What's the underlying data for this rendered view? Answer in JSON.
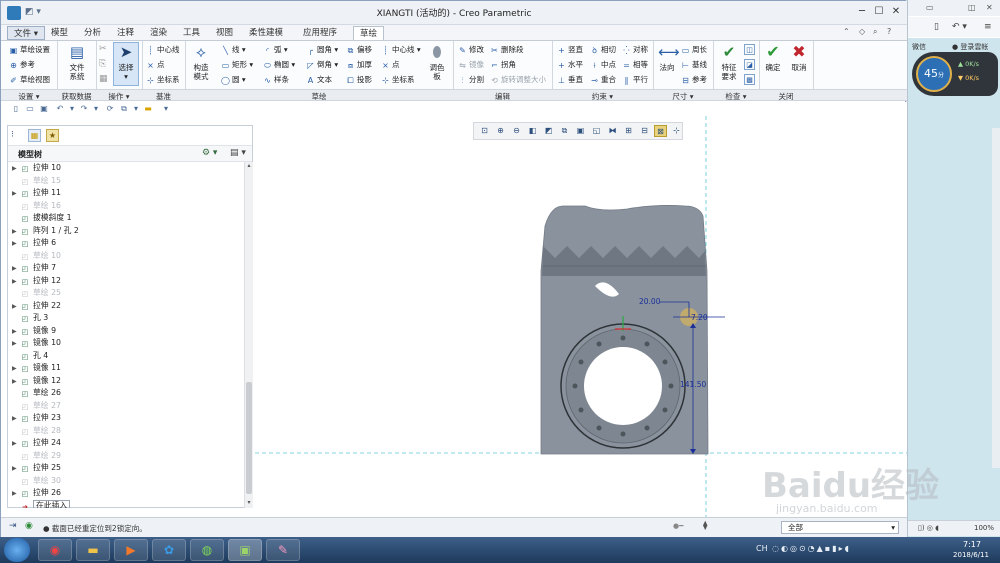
{
  "window": {
    "title": "XIANGTI (活动的) - Creo Parametric",
    "controls": [
      "─",
      "☐",
      "✕"
    ]
  },
  "menu_tabs": [
    "文件",
    "模型",
    "分析",
    "注释",
    "渲染",
    "工具",
    "视图",
    "柔性建模",
    "应用程序",
    "草绘"
  ],
  "ribbon": {
    "setup": {
      "items": [
        "草绘设置",
        "参考",
        "草绘视图"
      ]
    },
    "get_data": {
      "file_system": "文件\n系统"
    },
    "operations": {
      "select": "选择"
    },
    "datum": {
      "items": [
        "中心线",
        "点",
        "坐标系"
      ]
    },
    "sketch": {
      "construct_mode": "构造\n模式",
      "col1": [
        "线",
        "矩形",
        "圆"
      ],
      "col2": [
        "弧",
        "椭圆",
        "样条"
      ],
      "col3": [
        "圆角",
        "倒角",
        "文本"
      ],
      "col4": [
        "偏移",
        "加厚",
        "投影"
      ],
      "col5": [
        "中心线",
        "点",
        "坐标系"
      ],
      "palette": "调色\n板"
    },
    "edit": {
      "items": [
        "修改",
        "删除段",
        "镜像",
        "拐角",
        "分割",
        "旋转调整大小"
      ]
    },
    "constrain": {
      "items": [
        "竖直",
        "相切",
        "对称",
        "水平",
        "中点",
        "相等",
        "垂直",
        "重合",
        "平行"
      ]
    },
    "dimension": {
      "normal": "法向",
      "items": [
        "周长",
        "基线",
        "参考"
      ]
    },
    "inspect": {
      "feature_req": "特征\n要求"
    },
    "close": {
      "ok": "确定",
      "cancel": "取消"
    }
  },
  "group_labels": [
    "设置 ▾",
    "获取数据",
    "操作 ▾",
    "基准",
    "草绘",
    "编辑",
    "约束 ▾",
    "尺寸 ▾",
    "检查 ▾",
    "关闭"
  ],
  "model_tree": {
    "header": "模型树",
    "items": [
      {
        "label": "拉伸 10",
        "dim": false,
        "arrow": true
      },
      {
        "label": "草绘 15",
        "dim": true,
        "arrow": false
      },
      {
        "label": "拉伸 11",
        "dim": false,
        "arrow": true
      },
      {
        "label": "草绘 16",
        "dim": true,
        "arrow": false
      },
      {
        "label": "拔模斜度 1",
        "dim": false,
        "arrow": false
      },
      {
        "label": "阵列 1 / 孔 2",
        "dim": false,
        "arrow": true
      },
      {
        "label": "拉伸 6",
        "dim": false,
        "arrow": true
      },
      {
        "label": "草绘 10",
        "dim": true,
        "arrow": false
      },
      {
        "label": "拉伸 7",
        "dim": false,
        "arrow": true
      },
      {
        "label": "拉伸 12",
        "dim": false,
        "arrow": true
      },
      {
        "label": "草绘 25",
        "dim": true,
        "arrow": false
      },
      {
        "label": "拉伸 22",
        "dim": false,
        "arrow": true
      },
      {
        "label": "孔 3",
        "dim": false,
        "arrow": false
      },
      {
        "label": "镜像 9",
        "dim": false,
        "arrow": true
      },
      {
        "label": "镜像 10",
        "dim": false,
        "arrow": true
      },
      {
        "label": "孔 4",
        "dim": false,
        "arrow": false
      },
      {
        "label": "镜像 11",
        "dim": false,
        "arrow": true
      },
      {
        "label": "镜像 12",
        "dim": false,
        "arrow": true
      },
      {
        "label": "草绘 26",
        "dim": false,
        "arrow": false
      },
      {
        "label": "草绘 27",
        "dim": true,
        "arrow": false
      },
      {
        "label": "拉伸 23",
        "dim": false,
        "arrow": true
      },
      {
        "label": "草绘 28",
        "dim": true,
        "arrow": false
      },
      {
        "label": "拉伸 24",
        "dim": false,
        "arrow": true
      },
      {
        "label": "草绘 29",
        "dim": true,
        "arrow": false
      },
      {
        "label": "拉伸 25",
        "dim": false,
        "arrow": true
      },
      {
        "label": "草绘 30",
        "dim": true,
        "arrow": false
      },
      {
        "label": "拉伸 26",
        "dim": false,
        "arrow": true
      },
      {
        "label": "在此插入",
        "dim": false,
        "arrow": false
      }
    ]
  },
  "canvas": {
    "dim_horizontal": "20.00",
    "dim_radius": "7.20",
    "dim_vertical": "141.50"
  },
  "status": {
    "message": "● 截面已经重定位到2锁定向。",
    "selection_filter": "全部"
  },
  "right_browser": {
    "login": "登录雲帐",
    "search": "微信",
    "speed_percent": "45",
    "speed_unit": "分",
    "upload": "0K/s",
    "download": "0K/s",
    "zoom": "100%"
  },
  "taskbar": {
    "lang": "CH",
    "time": "7:17",
    "date": "2018/6/11"
  },
  "watermark": {
    "brand": "Baidu经验",
    "url": "jingyan.baidu.com"
  },
  "colors": {
    "model": "#8a939d",
    "dimension": "#1a2f9a",
    "guide": "#5bc6d9"
  }
}
